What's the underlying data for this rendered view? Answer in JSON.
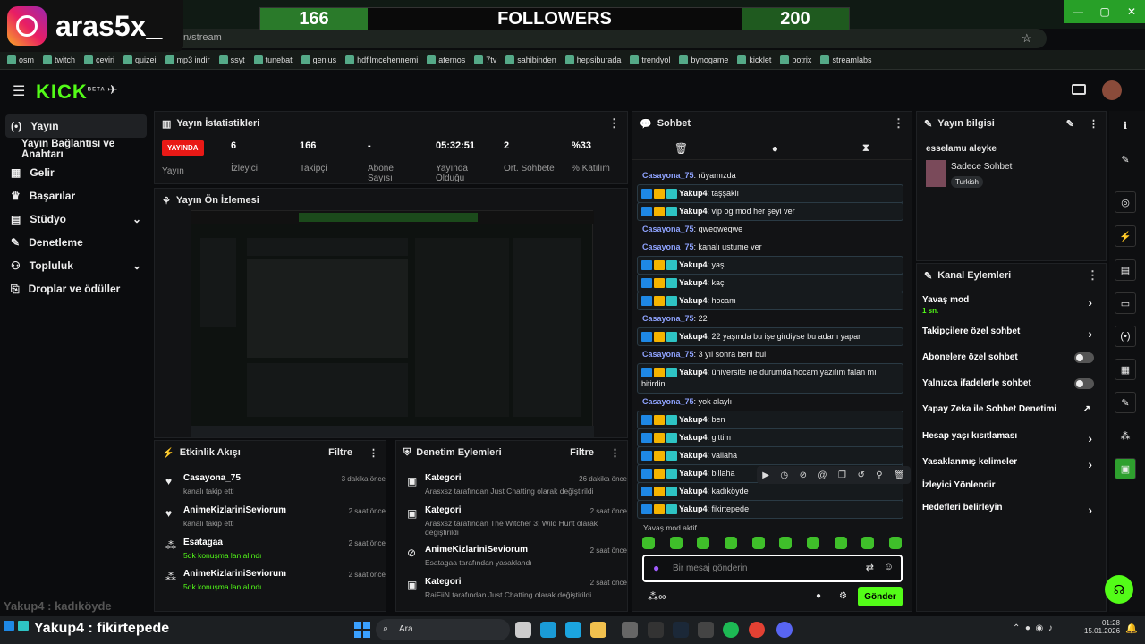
{
  "overlay": {
    "logo_name": "aras5x_",
    "followers_current": "166",
    "followers_label": "FOLLOWERS",
    "followers_goal": "200"
  },
  "browser": {
    "url": "n/stream",
    "bookmarks": [
      "osm",
      "twitch",
      "çeviri",
      "quizei",
      "mp3 indir",
      "ssyt",
      "tunebat",
      "genius",
      "hdfilmcehennemi",
      "aternos",
      "7tv",
      "sahibinden",
      "hepsiburada",
      "trendyol",
      "bynogame",
      "kicklet",
      "botrix",
      "streamlabs"
    ]
  },
  "header": {
    "logo": "KICK",
    "beta": "BETA"
  },
  "sidebar": {
    "items": [
      {
        "label": "Yayın",
        "icon": "live-icon"
      },
      {
        "label": "Yayın Bağlantısı ve Anahtarı"
      },
      {
        "label": "Gelir"
      },
      {
        "label": "Başarılar"
      },
      {
        "label": "Stüdyo"
      },
      {
        "label": "Denetleme"
      },
      {
        "label": "Topluluk"
      },
      {
        "label": "Droplar ve ödüller"
      }
    ]
  },
  "stats": {
    "title": "Yayın İstatistikleri",
    "live_badge": "YAYINDA",
    "items": [
      {
        "value": "",
        "label": "Yayın"
      },
      {
        "value": "6",
        "label": "İzleyici"
      },
      {
        "value": "166",
        "label": "Takipçi"
      },
      {
        "value": "-",
        "label": "Abone Sayısı"
      },
      {
        "value": "05:32:51",
        "label": "Yayında Olduğu"
      },
      {
        "value": "2",
        "label": "Ort. Sohbete"
      },
      {
        "value": "%33",
        "label": "% Katılım"
      }
    ]
  },
  "preview": {
    "title": "Yayın Ön İzlemesi"
  },
  "activity": {
    "title": "Etkinlik Akışı",
    "filter": "Filtre",
    "items": [
      {
        "name": "Casayona_75",
        "sub": "kanalı takip etti",
        "time": "3 dakika önce"
      },
      {
        "name": "AnimeKizlariniSeviorum",
        "sub": "kanalı takip etti",
        "time": "2 saat önce"
      },
      {
        "name": "Esatagaa",
        "sub": "5dk konuşma lan alındı",
        "time": "2 saat önce"
      },
      {
        "name": "AnimeKizlariniSeviorum",
        "sub": "5dk konuşma lan alındı",
        "time": "2 saat önce"
      }
    ]
  },
  "moderation": {
    "title": "Denetim Eylemleri",
    "filter": "Filtre",
    "items": [
      {
        "name": "Kategori",
        "sub": "Arasxsz tarafından Just Chatting olarak değiştirildi",
        "time": "26 dakika önce"
      },
      {
        "name": "Kategori",
        "sub": "Arasxsz tarafından The Witcher 3: Wild Hunt olarak değiştirildi",
        "time": "2 saat önce"
      },
      {
        "name": "AnimeKizlariniSeviorum",
        "sub": "Esatagaa tarafından yasaklandı",
        "time": "2 saat önce"
      },
      {
        "name": "Kategori",
        "sub": "RaiFiiN tarafından Just Chatting olarak değiştirildi",
        "time": "2 saat önce"
      }
    ]
  },
  "chat": {
    "title": "Sohbet",
    "messages": [
      {
        "user": "Casayona_75",
        "text": "rüyamızda",
        "boxed": false
      },
      {
        "user": "Yakup4",
        "text": "taşşaklı",
        "boxed": true
      },
      {
        "user": "Yakup4",
        "text": "vip og mod her şeyi ver",
        "boxed": true
      },
      {
        "user": "Casayona_75",
        "text": "qweqweqwe",
        "boxed": false
      },
      {
        "user": "Casayona_75",
        "text": "kanalı ustume ver",
        "boxed": false
      },
      {
        "user": "Yakup4",
        "text": "yaş",
        "boxed": true
      },
      {
        "user": "Yakup4",
        "text": "kaç",
        "boxed": true
      },
      {
        "user": "Yakup4",
        "text": "hocam",
        "boxed": true
      },
      {
        "user": "Casayona_75",
        "text": "22",
        "boxed": false
      },
      {
        "user": "Yakup4",
        "text": "22 yaşında bu işe girdiyse bu adam yapar",
        "boxed": true
      },
      {
        "user": "Casayona_75",
        "text": "3 yıl sonra beni bul",
        "boxed": false
      },
      {
        "user": "Yakup4",
        "text": "üniversite ne durumda hocam yazılım falan mı bitirdin",
        "boxed": true
      },
      {
        "user": "Casayona_75",
        "text": "yok alaylı",
        "boxed": false
      },
      {
        "user": "Yakup4",
        "text": "ben",
        "boxed": true
      },
      {
        "user": "Yakup4",
        "text": "gittim",
        "boxed": true
      },
      {
        "user": "Yakup4",
        "text": "vallaha",
        "boxed": true
      },
      {
        "user": "Yakup4",
        "text": "billaha",
        "boxed": true
      },
      {
        "user": "Yakup4",
        "text": "kadıköyde",
        "boxed": true
      },
      {
        "user": "Yakup4",
        "text": "fikirtepede",
        "boxed": true
      }
    ],
    "slow_mode": "Yavaş mod aktif",
    "input_placeholder": "Bir mesaj gönderin",
    "send": "Gönder"
  },
  "stream_info": {
    "title": "Yayın bilgisi",
    "stream_title": "esselamu aleyke",
    "category": "Sadece Sohbet",
    "language": "Turkish"
  },
  "channel_actions": {
    "title": "Kanal Eylemleri",
    "items": [
      {
        "label": "Yavaş mod",
        "sub": "1 sn.",
        "control": "chevron"
      },
      {
        "label": "Takipçilere özel sohbet",
        "control": "chevron"
      },
      {
        "label": "Abonelere özel sohbet",
        "control": "toggle"
      },
      {
        "label": "Yalnızca ifadelerle sohbet",
        "control": "toggle"
      },
      {
        "label": "Yapay Zeka ile Sohbet Denetimi",
        "control": "external"
      },
      {
        "label": "Hesap yaşı kısıtlaması",
        "control": "chevron"
      },
      {
        "label": "Yasaklanmış kelimeler",
        "control": "chevron"
      },
      {
        "label": "İzleyici Yönlendir",
        "control": "none"
      },
      {
        "label": "Hedefleri belirleyin",
        "control": "chevron"
      }
    ]
  },
  "bottom_overlay": {
    "ghost": "Yakup4 : kadıköyde",
    "main": "Yakup4 : fikirtepede"
  },
  "taskbar": {
    "search": "Ara",
    "time": "01:28",
    "date": "15.01.2026"
  },
  "colors": {
    "accent": "#53fc18",
    "live": "#e91916",
    "username": "#8fa3ff"
  }
}
